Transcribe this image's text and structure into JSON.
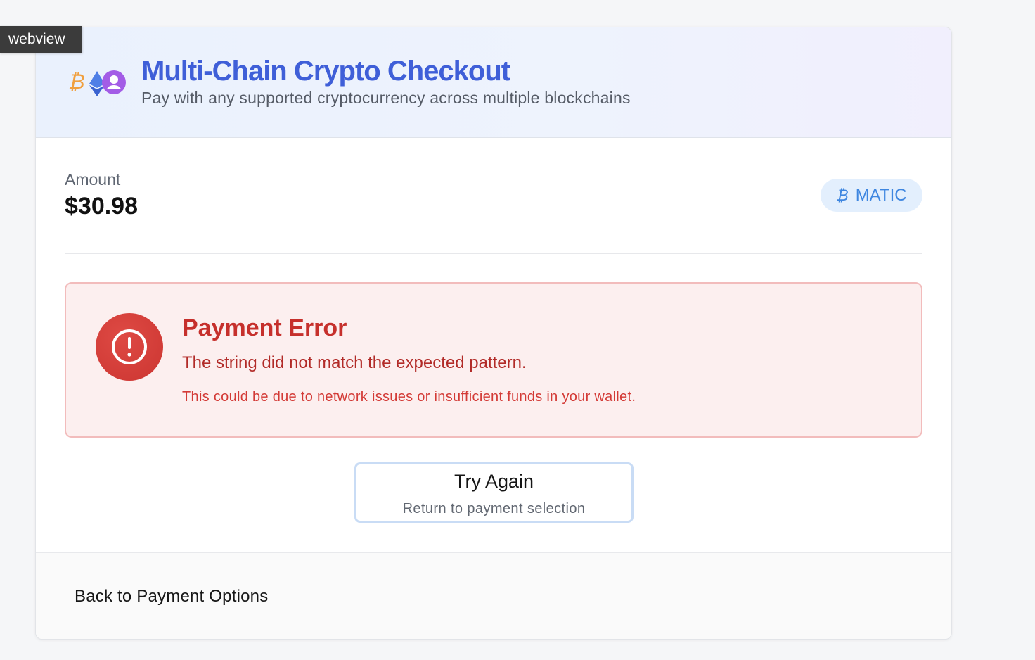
{
  "webview_tag": "webview",
  "header": {
    "title": "Multi-Chain Crypto Checkout",
    "subtitle": "Pay with any supported cryptocurrency across multiple blockchains",
    "logos": [
      "bitcoin-icon",
      "ethereum-icon",
      "polygon-icon"
    ],
    "btc_glyph": "₿"
  },
  "amount": {
    "label": "Amount",
    "value": "$30.98"
  },
  "currency_badge": {
    "symbol": "₿",
    "label": "MATIC"
  },
  "error": {
    "icon": "alert-circle-icon",
    "title": "Payment Error",
    "message": "The string did not match the expected pattern.",
    "hint": "This could be due to network issues or insufficient funds in your wallet."
  },
  "retry": {
    "title": "Try Again",
    "subtitle": "Return to payment selection"
  },
  "footer": {
    "back_label": "Back to Payment Options"
  },
  "colors": {
    "brand_blue": "#3f5fd8",
    "error_red": "#c6302c",
    "error_bg": "#fcefef",
    "badge_bg": "#e3effd",
    "badge_text": "#3e86e0",
    "bitcoin": "#f0a040",
    "polygon": "#a35ce6"
  }
}
